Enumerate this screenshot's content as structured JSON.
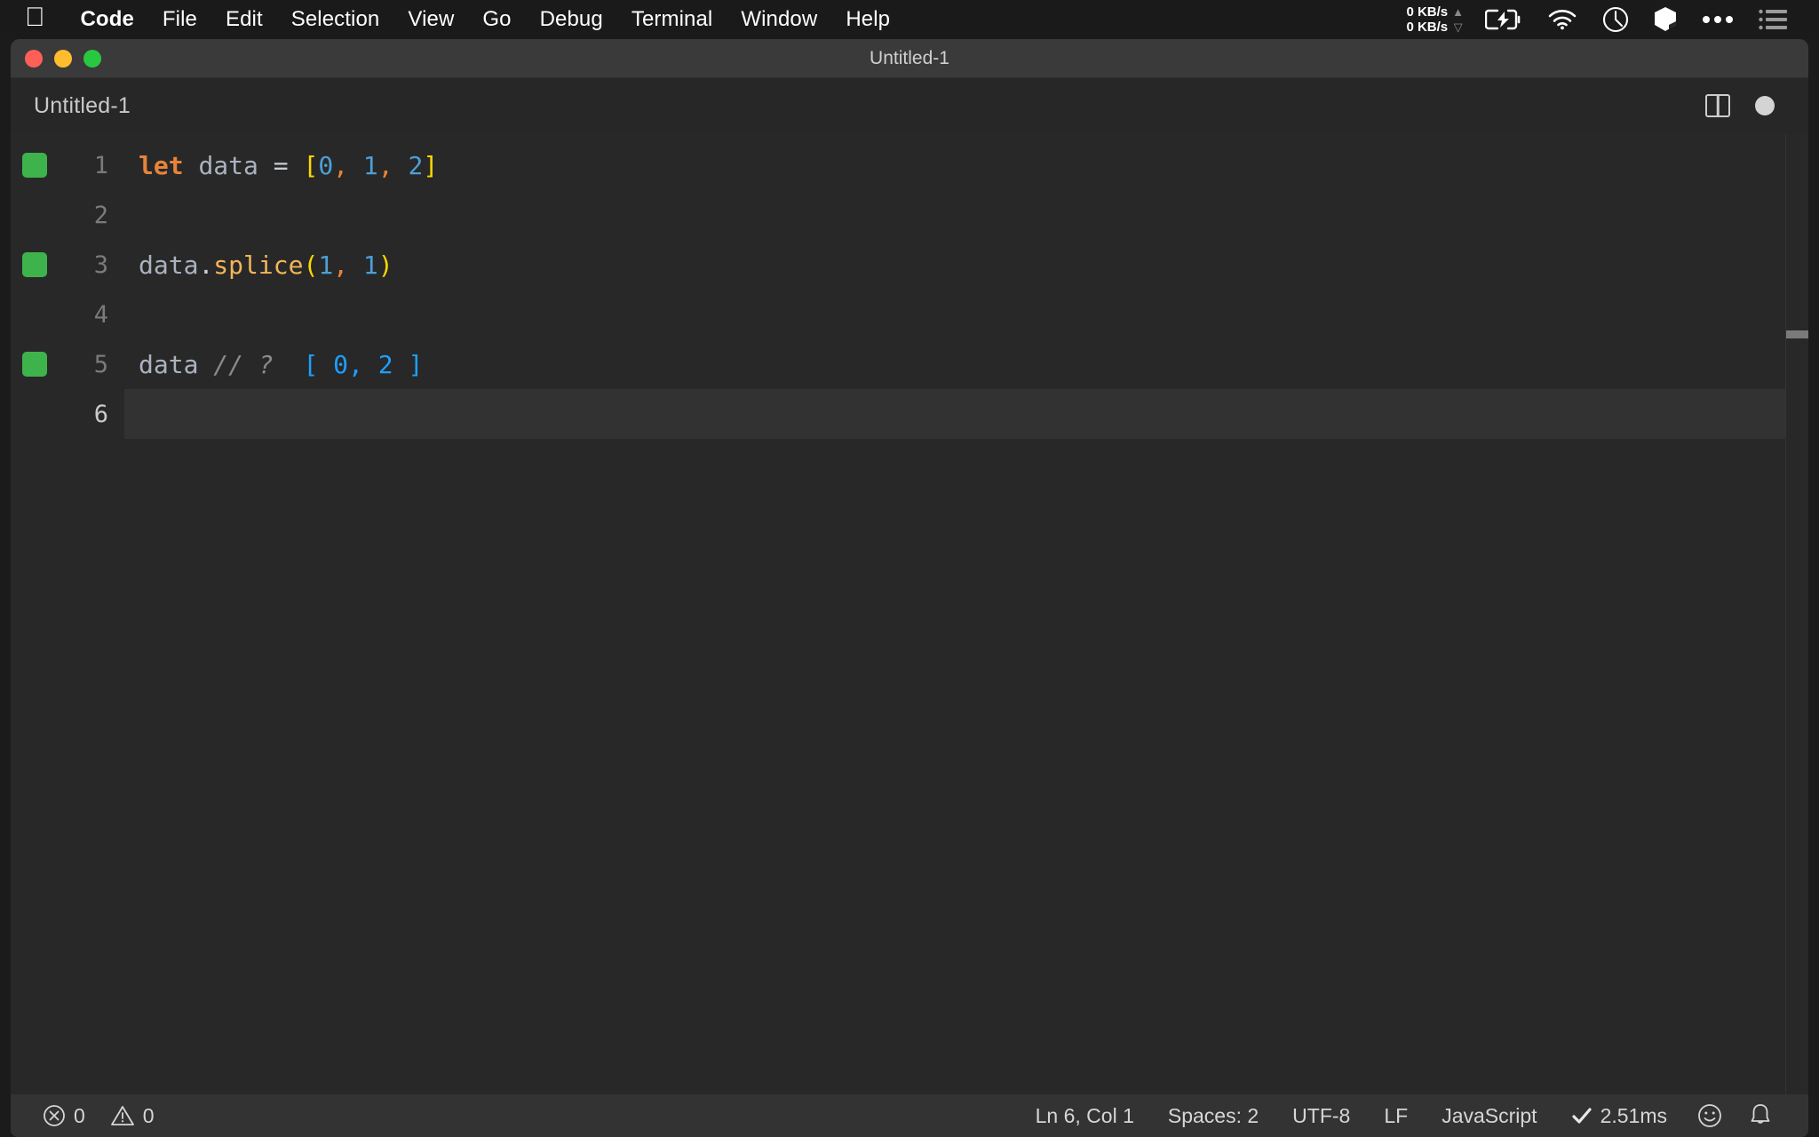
{
  "menubar": {
    "apple_icon": "apple-logo-icon",
    "items": [
      {
        "label": "Code",
        "bold": true
      },
      {
        "label": "File",
        "bold": false
      },
      {
        "label": "Edit",
        "bold": false
      },
      {
        "label": "Selection",
        "bold": false
      },
      {
        "label": "View",
        "bold": false
      },
      {
        "label": "Go",
        "bold": false
      },
      {
        "label": "Debug",
        "bold": false
      },
      {
        "label": "Terminal",
        "bold": false
      },
      {
        "label": "Window",
        "bold": false
      },
      {
        "label": "Help",
        "bold": false
      }
    ],
    "status": {
      "net_up": "0 KB/s",
      "net_down": "0 KB/s",
      "up_arrow": "▲",
      "down_arrow": "▽",
      "icons": [
        "battery-charging-icon",
        "wifi-icon",
        "clock-icon",
        "cube-icon",
        "ellipsis-icon",
        "list-icon"
      ]
    }
  },
  "window": {
    "title": "Untitled-1",
    "traffic_lights": [
      "close-button",
      "minimize-button",
      "zoom-button"
    ],
    "colors": {
      "close": "#ff5f57",
      "minimize": "#ffbd2e",
      "zoom": "#28c940"
    }
  },
  "tabstrip": {
    "tab_label": "Untitled-1",
    "actions": [
      "split-editor-icon",
      "unsaved-indicator"
    ]
  },
  "editor": {
    "language": "JavaScript",
    "lines": [
      {
        "number": "1",
        "coverage": true,
        "current": false,
        "tokens": [
          {
            "text": "let",
            "cls": "t-kw"
          },
          {
            "text": " ",
            "cls": "t-var"
          },
          {
            "text": "data",
            "cls": "t-var"
          },
          {
            "text": " ",
            "cls": "t-op"
          },
          {
            "text": "=",
            "cls": "t-op"
          },
          {
            "text": " ",
            "cls": "t-op"
          },
          {
            "text": "[",
            "cls": "t-bracket-y"
          },
          {
            "text": "0",
            "cls": "t-num"
          },
          {
            "text": ",",
            "cls": "t-comma"
          },
          {
            "text": " ",
            "cls": "t-op"
          },
          {
            "text": "1",
            "cls": "t-num"
          },
          {
            "text": ",",
            "cls": "t-comma"
          },
          {
            "text": " ",
            "cls": "t-op"
          },
          {
            "text": "2",
            "cls": "t-num"
          },
          {
            "text": "]",
            "cls": "t-bracket-y"
          }
        ]
      },
      {
        "number": "2",
        "coverage": false,
        "current": false,
        "tokens": []
      },
      {
        "number": "3",
        "coverage": true,
        "current": false,
        "tokens": [
          {
            "text": "data",
            "cls": "t-var"
          },
          {
            "text": ".",
            "cls": "t-punct"
          },
          {
            "text": "splice",
            "cls": "t-fn"
          },
          {
            "text": "(",
            "cls": "t-bracket-y"
          },
          {
            "text": "1",
            "cls": "t-num"
          },
          {
            "text": ",",
            "cls": "t-comma"
          },
          {
            "text": " ",
            "cls": "t-op"
          },
          {
            "text": "1",
            "cls": "t-num"
          },
          {
            "text": ")",
            "cls": "t-bracket-y"
          }
        ]
      },
      {
        "number": "4",
        "coverage": false,
        "current": false,
        "tokens": []
      },
      {
        "number": "5",
        "coverage": true,
        "current": false,
        "tokens": [
          {
            "text": "data",
            "cls": "t-var"
          },
          {
            "text": " ",
            "cls": "t-op"
          },
          {
            "text": "// ?",
            "cls": "t-comment"
          },
          {
            "text": "  ",
            "cls": "t-op"
          },
          {
            "text": "[ 0, 2 ]",
            "cls": "t-result"
          }
        ]
      },
      {
        "number": "6",
        "coverage": false,
        "current": true,
        "tokens": []
      }
    ]
  },
  "statusbar": {
    "left": [
      {
        "icon": "error-icon",
        "label": "0"
      },
      {
        "icon": "warning-icon",
        "label": "0"
      }
    ],
    "right": [
      {
        "name": "cursor-position",
        "label": "Ln 6, Col 1"
      },
      {
        "name": "indentation",
        "label": "Spaces: 2"
      },
      {
        "name": "encoding",
        "label": "UTF-8"
      },
      {
        "name": "line-endings",
        "label": "LF"
      },
      {
        "name": "language-mode",
        "label": "JavaScript"
      },
      {
        "name": "quokka-timing",
        "label": "2.51ms",
        "icon": "checkmark-icon"
      }
    ],
    "icons": [
      "feedback-smiley-icon",
      "notifications-bell-icon"
    ]
  },
  "colors": {
    "menubar_bg": "#1a1a1a",
    "titlebar_bg": "#3a3a3a",
    "editor_bg": "#282828",
    "statusbar_bg": "#333333",
    "coverage_green": "#3eb34b",
    "keyword_orange": "#e8833a",
    "number_blue": "#4d9fd6",
    "bracket_yellow": "#ffd700",
    "function_gold": "#f2b559",
    "result_blue": "#1e9eff",
    "comment_gray": "#8b8b8b"
  }
}
